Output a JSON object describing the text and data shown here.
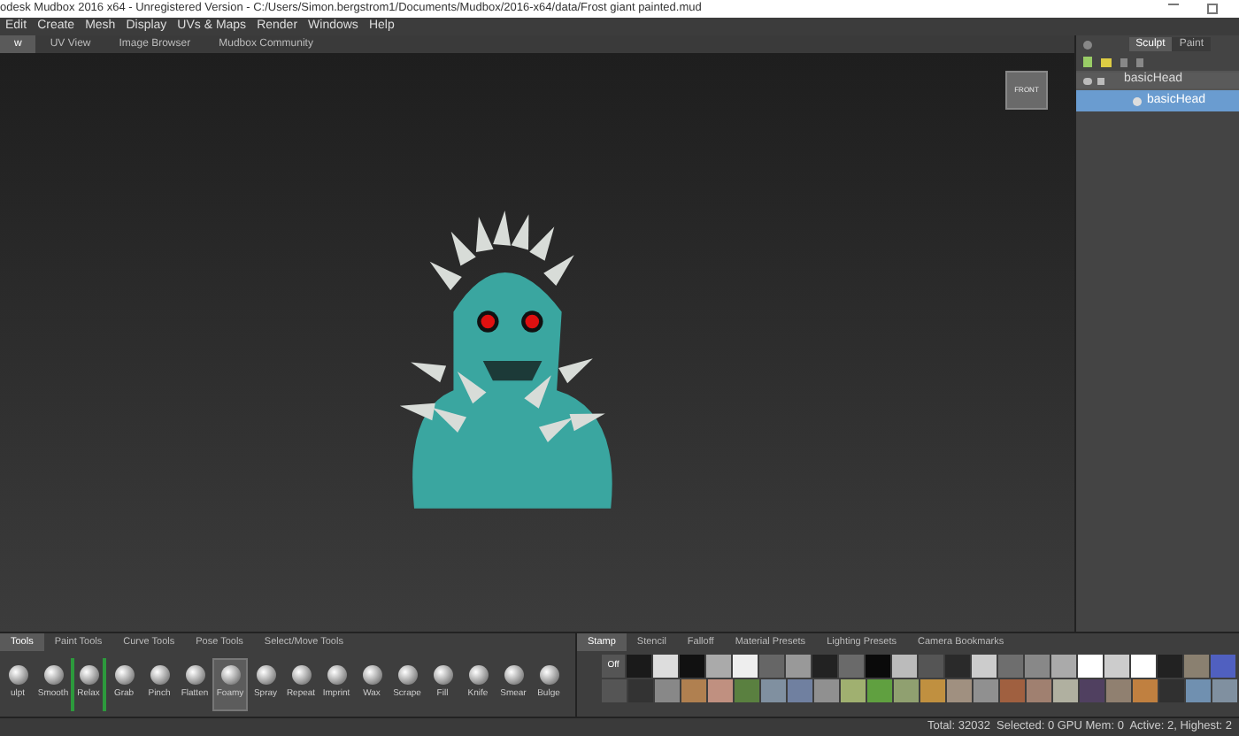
{
  "window": {
    "title": "odesk Mudbox 2016 x64 - Unregistered Version - C:/Users/Simon.bergstrom1/Documents/Mudbox/2016-x64/data/Frost giant painted.mud"
  },
  "menu": [
    "Edit",
    "Create",
    "Mesh",
    "Display",
    "UVs & Maps",
    "Render",
    "Windows",
    "Help"
  ],
  "view_tabs": [
    {
      "label": "w",
      "selected": true
    },
    {
      "label": "UV View",
      "selected": false
    },
    {
      "label": "Image Browser",
      "selected": false
    },
    {
      "label": "Mudbox Community",
      "selected": false
    }
  ],
  "viewport": {
    "view_cube_label": "FRONT"
  },
  "mode_tabs": [
    {
      "label": "Sculpt",
      "selected": true
    },
    {
      "label": "Paint",
      "selected": false
    }
  ],
  "layers": [
    {
      "name": "basicHead",
      "selected": false,
      "children": [
        {
          "name": "basicHead",
          "selected": true
        }
      ]
    }
  ],
  "tool_tabs": [
    {
      "label": "Tools",
      "selected": true
    },
    {
      "label": "Paint Tools",
      "selected": false
    },
    {
      "label": "Curve Tools",
      "selected": false
    },
    {
      "label": "Pose Tools",
      "selected": false
    },
    {
      "label": "Select/Move Tools",
      "selected": false
    }
  ],
  "tools": [
    {
      "label": "ulpt",
      "selected": false,
      "marked": false
    },
    {
      "label": "Smooth",
      "selected": false,
      "marked": false
    },
    {
      "label": "Relax",
      "selected": false,
      "marked": true
    },
    {
      "label": "Grab",
      "selected": false,
      "marked": false
    },
    {
      "label": "Pinch",
      "selected": false,
      "marked": false
    },
    {
      "label": "Flatten",
      "selected": false,
      "marked": false
    },
    {
      "label": "Foamy",
      "selected": true,
      "marked": false
    },
    {
      "label": "Spray",
      "selected": false,
      "marked": false
    },
    {
      "label": "Repeat",
      "selected": false,
      "marked": false
    },
    {
      "label": "Imprint",
      "selected": false,
      "marked": false
    },
    {
      "label": "Wax",
      "selected": false,
      "marked": false
    },
    {
      "label": "Scrape",
      "selected": false,
      "marked": false
    },
    {
      "label": "Fill",
      "selected": false,
      "marked": false
    },
    {
      "label": "Knife",
      "selected": false,
      "marked": false
    },
    {
      "label": "Smear",
      "selected": false,
      "marked": false
    },
    {
      "label": "Bulge",
      "selected": false,
      "marked": false
    }
  ],
  "tray_tabs": [
    {
      "label": "Stamp",
      "selected": true
    },
    {
      "label": "Stencil",
      "selected": false
    },
    {
      "label": "Falloff",
      "selected": false
    },
    {
      "label": "Material Presets",
      "selected": false
    },
    {
      "label": "Lighting Presets",
      "selected": false
    },
    {
      "label": "Camera Bookmarks",
      "selected": false
    }
  ],
  "stamps": {
    "off_label": "Off"
  },
  "status_bar": "Total: 32032  Selected: 0 GPU Mem: 0  Active: 2, Highest: 2"
}
